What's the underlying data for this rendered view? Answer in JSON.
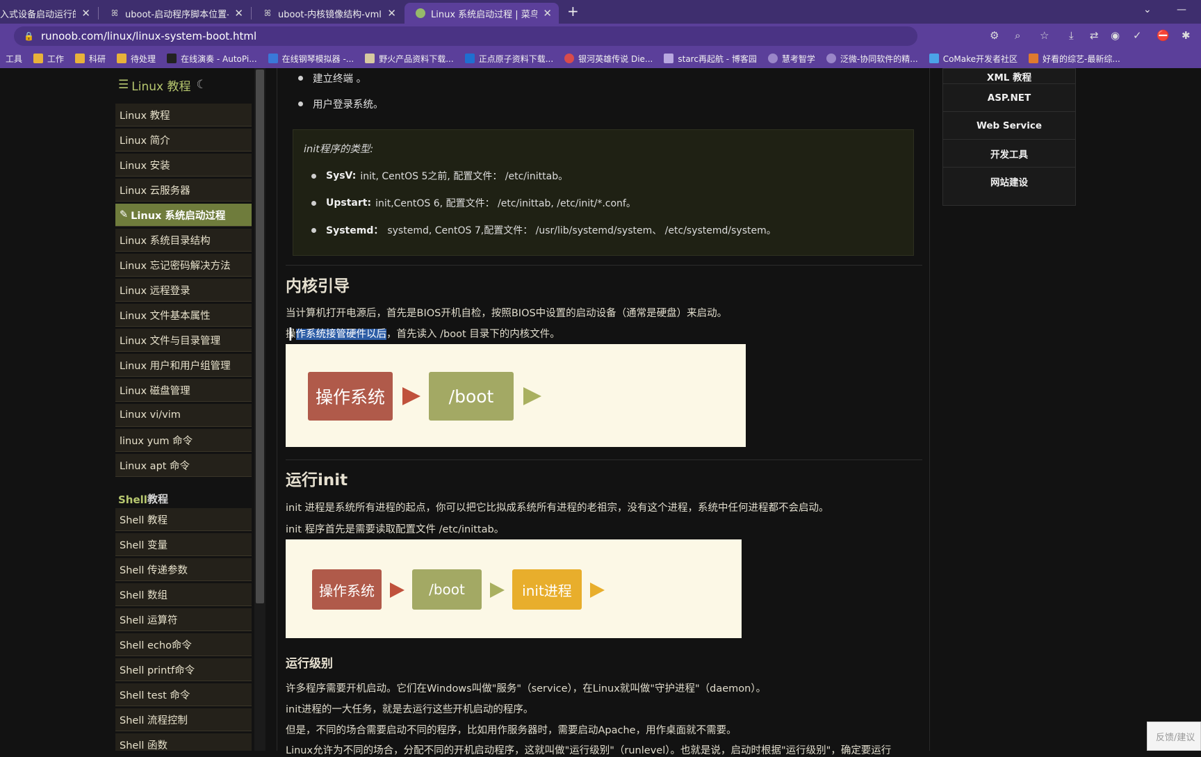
{
  "tabs": [
    {
      "title": "入式设备启动运行的",
      "active": false
    },
    {
      "title": "uboot-启动程序脚本位置-init",
      "active": false
    },
    {
      "title": "uboot-内核镜像结构-vmlinu",
      "active": false
    },
    {
      "title": "Linux 系统启动过程 | 菜鸟教程",
      "active": true
    }
  ],
  "address": "runoob.com/linux/linux-system-boot.html",
  "bookmarks": [
    "工具",
    "工作",
    "科研",
    "待处理",
    "在线演奏 - AutoPi...",
    "在线钢琴模拟器 -...",
    "野火产品资料下载...",
    "正点原子资料下载...",
    "银河英雄传说 Die...",
    "starc再起航 - 博客园",
    "慧考智学",
    "泛微-协同软件的精...",
    "CoMake开发者社区",
    "好看的综艺-最新综..."
  ],
  "nav": {
    "title": "Linux 教程",
    "items": [
      "Linux 教程",
      "Linux 简介",
      "Linux 安装",
      "Linux 云服务器",
      "Linux 系统启动过程",
      "Linux 系统目录结构",
      "Linux 忘记密码解决方法",
      "Linux 远程登录",
      "Linux 文件基本属性",
      "Linux 文件与目录管理",
      "Linux 用户和用户组管理",
      "Linux 磁盘管理",
      "Linux vi/vim",
      "linux yum 命令",
      "Linux apt 命令"
    ],
    "section2": {
      "prefix": "Shell",
      "rest": " 教程"
    },
    "shell_items": [
      "Shell 教程",
      "Shell 变量",
      "Shell 传递参数",
      "Shell 数组",
      "Shell 运算符",
      "Shell echo命令",
      "Shell printf命令",
      "Shell test 命令",
      "Shell 流程控制",
      "Shell 函数"
    ]
  },
  "content": {
    "bullet1": "建立终端 。",
    "bullet2": "用户登录系统。",
    "note_title": "init程序的类型:",
    "note_rows": [
      {
        "label": "SysV:",
        "text": "init, CentOS 5之前, 配置文件： /etc/inittab。"
      },
      {
        "label": "Upstart:",
        "text": "init,CentOS 6, 配置文件： /etc/inittab, /etc/init/*.conf。"
      },
      {
        "label": "Systemd：",
        "text": "systemd, CentOS 7,配置文件： /usr/lib/systemd/system、 /etc/systemd/system。"
      }
    ],
    "h_kernel": "内核引导",
    "p_kernel1": "当计算机打开电源后，首先是BIOS开机自检，按照BIOS中设置的启动设备（通常是硬盘）来启动。",
    "p_kernel2_pre": "操",
    "p_kernel2_sel": "作系统接管硬件以后",
    "p_kernel2_post": "，首先读入 /boot 目录下的内核文件。",
    "diag1": {
      "box1": "操作系统",
      "box2": "/boot"
    },
    "h_init": "运行init",
    "p_init1": "init 进程是系统所有进程的起点，你可以把它比拟成系统所有进程的老祖宗，没有这个进程，系统中任何进程都不会启动。",
    "p_init2": "init 程序首先是需要读取配置文件 /etc/inittab。",
    "diag2": {
      "box1": "操作系统",
      "box2": "/boot",
      "box3": "init进程"
    },
    "h_level": "运行级别",
    "p_level1": "许多程序需要开机启动。它们在Windows叫做\"服务\"（service），在Linux就叫做\"守护进程\"（daemon）。",
    "p_level2": "init进程的一大任务，就是去运行这些开机启动的程序。",
    "p_level3": "但是，不同的场合需要启动不同的程序，比如用作服务器时，需要启动Apache，用作桌面就不需要。",
    "p_level4": "Linux允许为不同的场合，分配不同的开机启动程序，这就叫做\"运行级别\"（runlevel）。也就是说，启动时根据\"运行级别\"，确定要运行"
  },
  "right": [
    "XML 教程",
    "ASP.NET",
    "Web Service",
    "开发工具",
    "网站建设"
  ],
  "feedback": "反馈/建议",
  "colors": {
    "accent": "#b7c76f",
    "nav_active": "#6f7c3c",
    "box_red": "#b05a4a",
    "box_green": "#a3a964",
    "box_yellow": "#e8ae2c",
    "arrow_red": "#c0523c",
    "arrow_green": "#a9b060"
  }
}
